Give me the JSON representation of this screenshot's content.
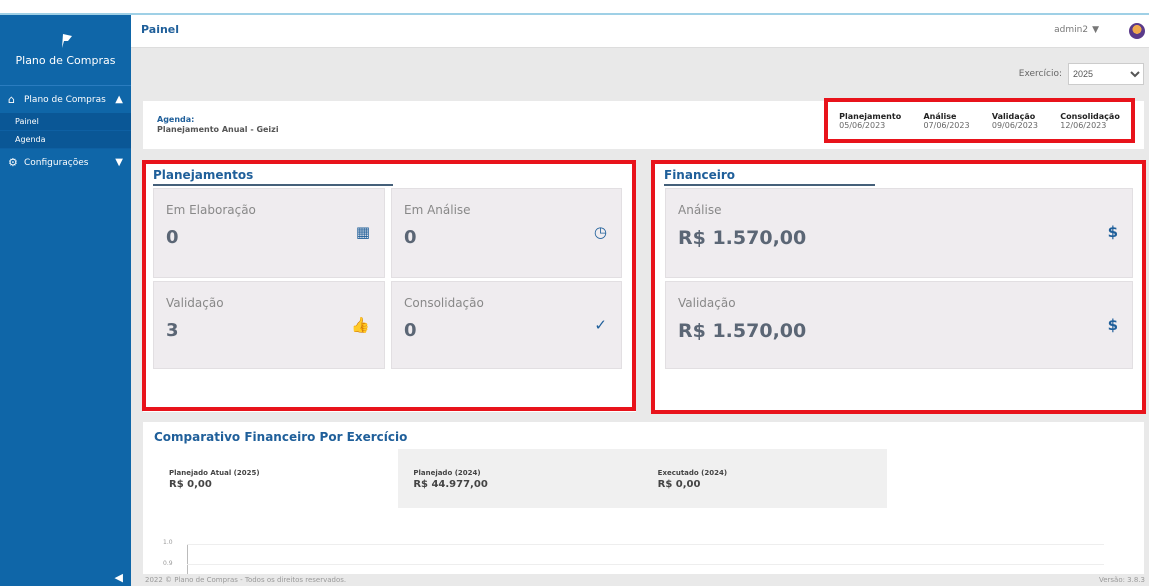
{
  "sidebar": {
    "brand": "Plano de Compras",
    "group": "Plano de Compras",
    "items": [
      "Painel",
      "Agenda"
    ],
    "config": "Configurações"
  },
  "header": {
    "title": "Painel",
    "user": "admin2"
  },
  "exercicio": {
    "label": "Exercício:",
    "value": "2025"
  },
  "agenda": {
    "label": "Agenda:",
    "name": "Planejamento Anual - Geizi",
    "phases": [
      {
        "name": "Planejamento",
        "date": "05/06/2023"
      },
      {
        "name": "Análise",
        "date": "07/06/2023"
      },
      {
        "name": "Validação",
        "date": "09/06/2023"
      },
      {
        "name": "Consolidação",
        "date": "12/06/2023"
      }
    ]
  },
  "planejamentos": {
    "title": "Planejamentos",
    "cards": [
      {
        "label": "Em Elaboração",
        "value": "0",
        "icon": "calendar-icon"
      },
      {
        "label": "Em Análise",
        "value": "0",
        "icon": "clock-icon"
      },
      {
        "label": "Validação",
        "value": "3",
        "icon": "thumbs-up-icon"
      },
      {
        "label": "Consolidação",
        "value": "0",
        "icon": "check-icon"
      }
    ]
  },
  "financeiro": {
    "title": "Financeiro",
    "cards": [
      {
        "label": "Análise",
        "value": "R$ 1.570,00",
        "icon": "dollar-icon"
      },
      {
        "label": "Validação",
        "value": "R$ 1.570,00",
        "icon": "dollar-icon"
      }
    ]
  },
  "comparativo": {
    "title": "Comparativo Financeiro Por Exercício",
    "tabs": [
      {
        "label": "Planejado Atual (2025)",
        "value": "R$ 0,00"
      },
      {
        "label": "Planejado (2024)",
        "value": "R$ 44.977,00"
      },
      {
        "label": "Executado (2024)",
        "value": "R$ 0,00"
      }
    ],
    "y_ticks": [
      "1.0",
      "0.9"
    ]
  },
  "footer": {
    "copyright": "2022 © Plano de Compras - Todos os direitos reservados.",
    "version": "Versão: 3.8.3"
  },
  "colors": {
    "sidebar": "#0f66a8",
    "accent": "#1f5f9a",
    "highlight": "#e8131b"
  }
}
